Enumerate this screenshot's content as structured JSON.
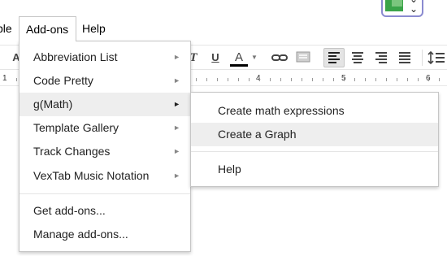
{
  "menubar": {
    "table_label": "ble",
    "addons_label": "Add-ons",
    "help_label": "Help"
  },
  "toolbar": {
    "partial_letter": "A",
    "italic": "T",
    "underline": "U",
    "text_color": "A",
    "text_color_bar": "#000000"
  },
  "ruler": {
    "labels": [
      "1",
      "4",
      "5",
      "6"
    ]
  },
  "addons_menu": {
    "items": [
      {
        "label": "Abbreviation List",
        "has_submenu": true
      },
      {
        "label": "Code Pretty",
        "has_submenu": true
      },
      {
        "label": "g(Math)",
        "has_submenu": true,
        "active": true
      },
      {
        "label": "Template Gallery",
        "has_submenu": true
      },
      {
        "label": "Track Changes",
        "has_submenu": true
      },
      {
        "label": "VexTab Music Notation",
        "has_submenu": true
      }
    ],
    "footer": [
      {
        "label": "Get add-ons..."
      },
      {
        "label": "Manage add-ons..."
      }
    ],
    "arrow": "►"
  },
  "gmath_submenu": {
    "items": [
      {
        "label": "Create math expressions"
      },
      {
        "label": "Create a Graph",
        "hover": true
      }
    ],
    "help_label": "Help"
  },
  "colors": {
    "menu_border": "#c6c6c6",
    "hover_bg": "#eeeeee",
    "addon_icon_border": "#8a8ad0",
    "addon_icon_green": "#3aa449"
  }
}
